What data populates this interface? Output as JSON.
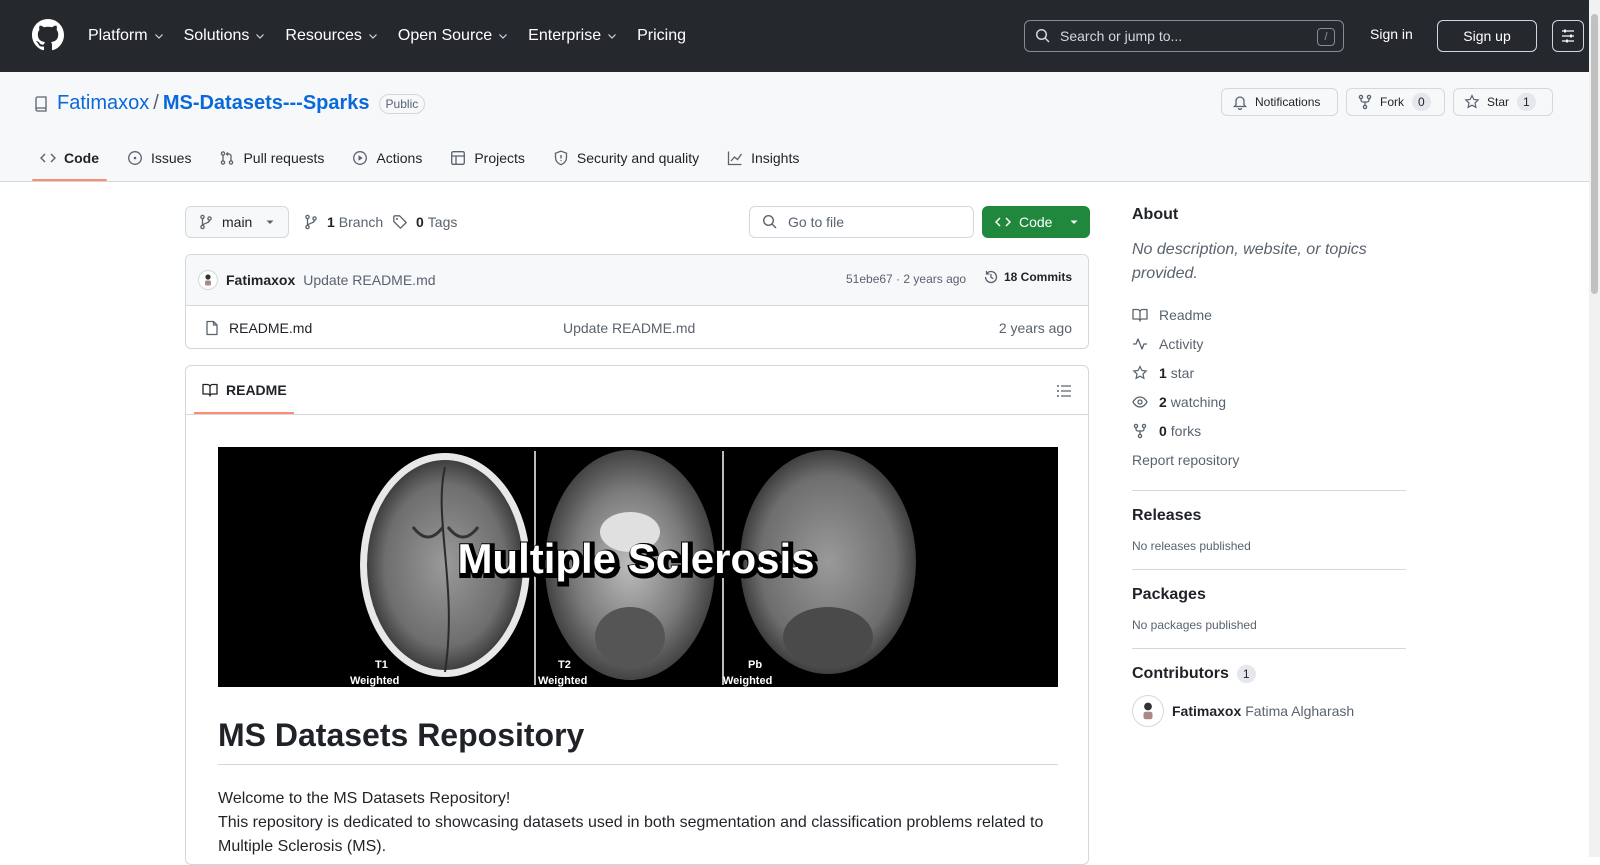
{
  "header": {
    "nav": [
      {
        "label": "Platform"
      },
      {
        "label": "Solutions"
      },
      {
        "label": "Resources"
      },
      {
        "label": "Open Source"
      },
      {
        "label": "Enterprise"
      },
      {
        "label": "Pricing"
      }
    ],
    "search_placeholder": "Search or jump to...",
    "search_shortcut": "/",
    "sign_in": "Sign in",
    "sign_up": "Sign up"
  },
  "repo": {
    "owner": "Fatimaxox",
    "sep": "/",
    "name": "MS-Datasets---Sparks",
    "visibility": "Public",
    "notifications": "Notifications",
    "fork_label": "Fork",
    "fork_count": "0",
    "star_label": "Star",
    "star_count": "1"
  },
  "tabs": [
    {
      "label": "Code"
    },
    {
      "label": "Issues"
    },
    {
      "label": "Pull requests"
    },
    {
      "label": "Actions"
    },
    {
      "label": "Projects"
    },
    {
      "label": "Security and quality"
    },
    {
      "label": "Insights"
    }
  ],
  "toolbar": {
    "branch": "main",
    "branch_count": "1",
    "branch_label": "Branch",
    "tag_count": "0",
    "tag_label": "Tags",
    "goto": "Go to file",
    "code": "Code"
  },
  "commit": {
    "author": "Fatimaxox",
    "message": "Update README.md",
    "hash": "51ebe67 · 2 years ago",
    "commits": "18 Commits"
  },
  "files": [
    {
      "name": "README.md",
      "message": "Update README.md",
      "age": "2 years ago"
    }
  ],
  "readme": {
    "tab": "README",
    "banner_title": "Multiple Sclerosis",
    "banner_labels": [
      "T1\nWeighted",
      "T2\nWeighted",
      "Pb\nWeighted"
    ],
    "heading": "MS Datasets Repository",
    "p1": "Welcome to the MS Datasets Repository!",
    "p2": "This repository is dedicated to showcasing datasets used in both segmentation and classification problems related to Multiple Sclerosis (MS)."
  },
  "about": {
    "title": "About",
    "desc": "No description, website, or topics provided.",
    "readme": "Readme",
    "activity": "Activity",
    "stars_n": "1",
    "stars": "star",
    "watching_n": "2",
    "watching": "watching",
    "forks_n": "0",
    "forks": "forks",
    "report": "Report repository"
  },
  "releases": {
    "title": "Releases",
    "text": "No releases published"
  },
  "packages": {
    "title": "Packages",
    "text": "No packages published"
  },
  "contributors": {
    "title": "Contributors",
    "count": "1",
    "login": "Fatimaxox",
    "name": "Fatima Algharash"
  }
}
